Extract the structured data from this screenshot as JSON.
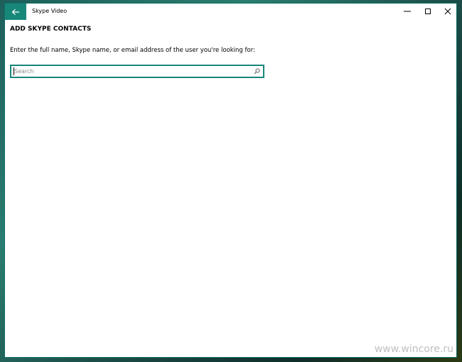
{
  "window": {
    "app_title": "Skype Video",
    "back_icon": "arrow-left-icon",
    "controls": {
      "minimize_icon": "minimize-icon",
      "maximize_icon": "maximize-icon",
      "close_icon": "close-icon"
    }
  },
  "page": {
    "heading": "ADD SKYPE CONTACTS",
    "instructions": "Enter the full name, Skype name, or email address of the user you're looking for:",
    "search": {
      "placeholder": "Search",
      "value": "",
      "icon": "search-icon"
    }
  },
  "watermark": "www.wincore.ru",
  "colors": {
    "accent": "#17877a",
    "window_border": "#0f6e66"
  }
}
